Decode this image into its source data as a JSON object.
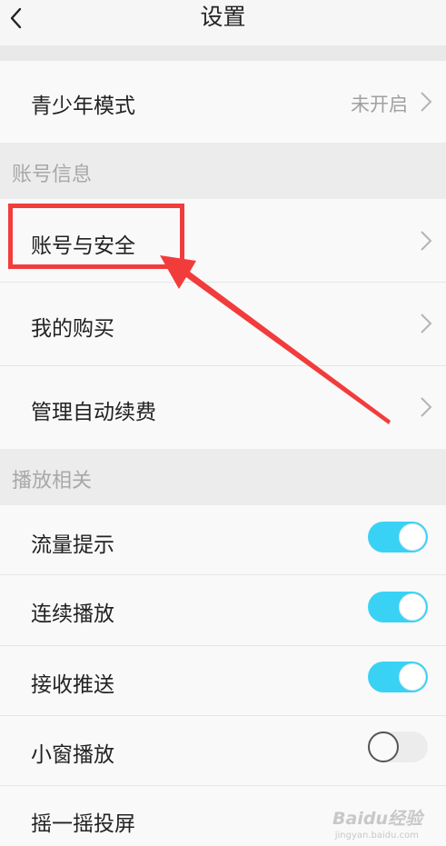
{
  "header": {
    "title": "设置"
  },
  "rows_top": [
    {
      "label": "青少年模式",
      "value": "未开启"
    }
  ],
  "sections": [
    {
      "title": "账号信息",
      "items": [
        {
          "label": "账号与安全"
        },
        {
          "label": "我的购买"
        },
        {
          "label": "管理自动续费"
        }
      ]
    },
    {
      "title": "播放相关",
      "items": [
        {
          "label": "流量提示",
          "toggle": true
        },
        {
          "label": "连续播放",
          "toggle": true
        },
        {
          "label": "接收推送",
          "toggle": true
        },
        {
          "label": "小窗播放",
          "toggle": false
        },
        {
          "label": "摇一摇投屏"
        }
      ]
    }
  ],
  "colors": {
    "toggle_on": "#39d2f5",
    "annotation": "#f23c3c"
  },
  "watermark": {
    "brand": "Baidu经验",
    "sub": "jingyan.baidu.com"
  }
}
